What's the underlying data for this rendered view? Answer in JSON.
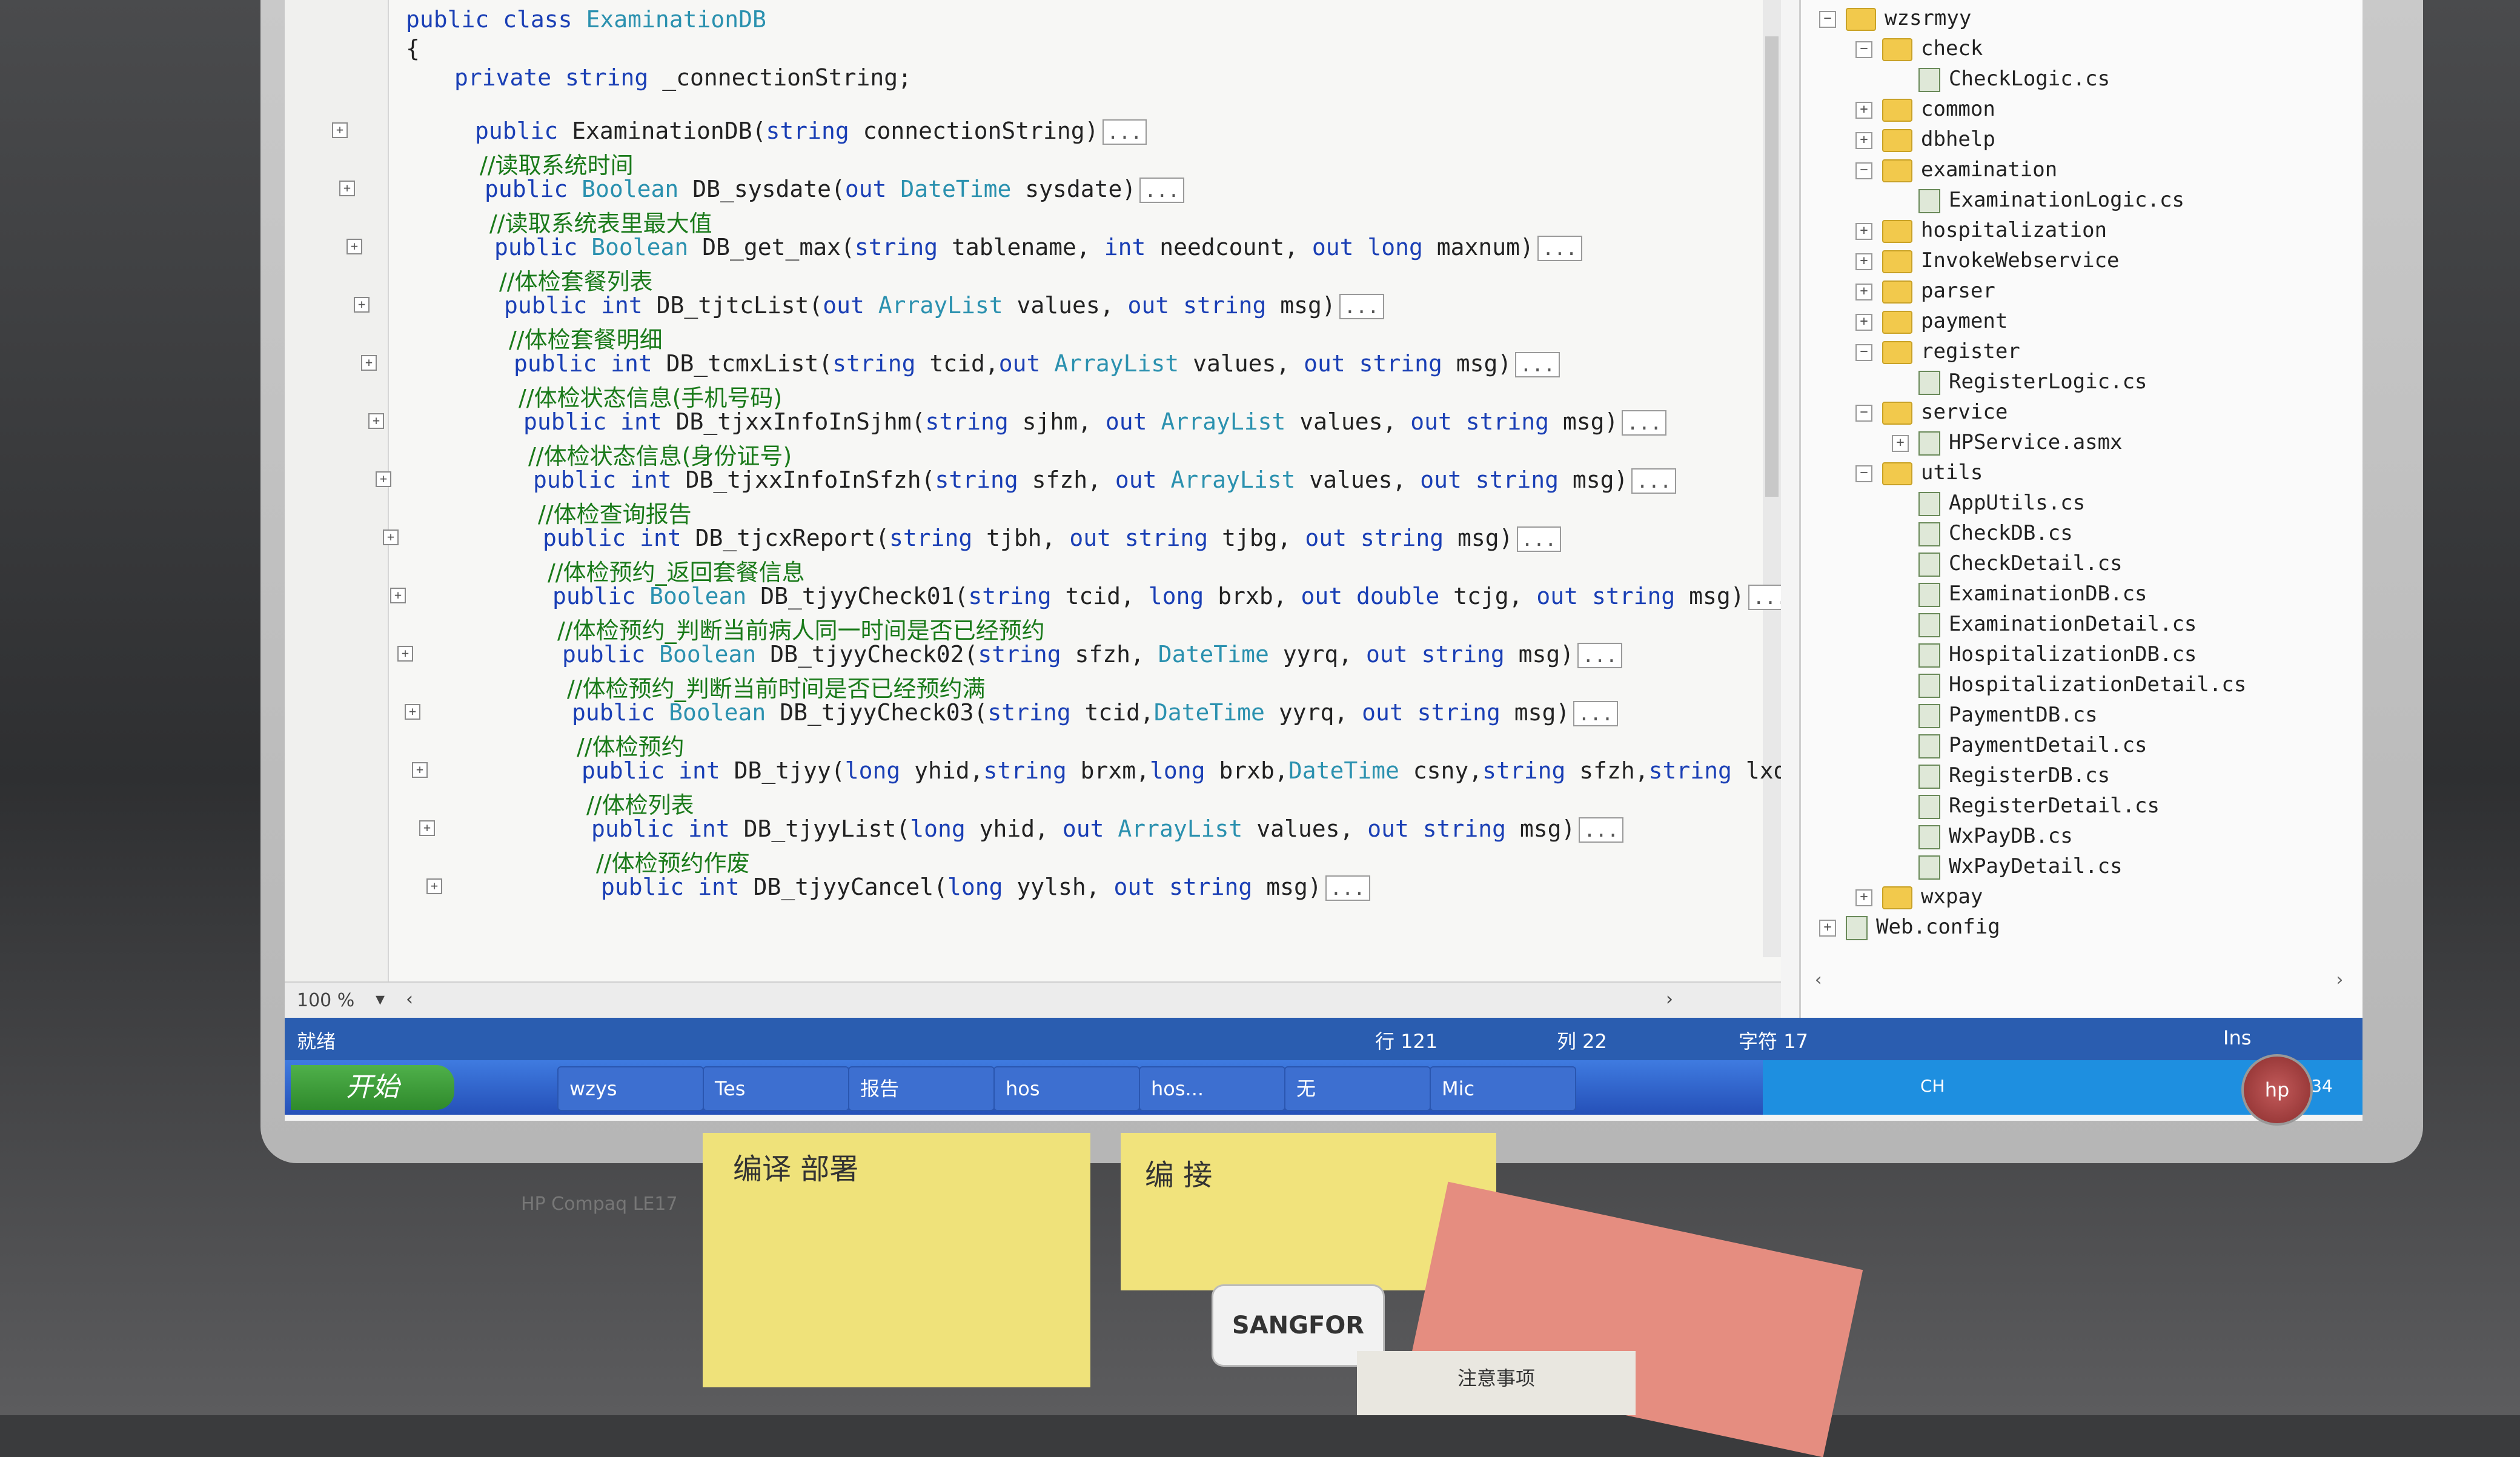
{
  "editor": {
    "zoom": "100 %",
    "lines": [
      {
        "kind": "code",
        "parts": [
          [
            "kw",
            "public "
          ],
          [
            "kw",
            "class "
          ],
          [
            "ty",
            "ExaminationDB"
          ]
        ]
      },
      {
        "kind": "code",
        "parts": [
          [
            "pl",
            "{"
          ]
        ]
      },
      {
        "kind": "code",
        "parts": [
          [
            "kw",
            "private "
          ],
          [
            "kw",
            "string "
          ],
          [
            "pl",
            "_connectionString;"
          ]
        ]
      },
      {
        "kind": "code",
        "parts": [
          [
            "kw",
            "public "
          ],
          [
            "pl",
            "ExaminationDB("
          ],
          [
            "kw",
            "string "
          ],
          [
            "pl",
            "connectionString)"
          ]
        ],
        "collapsed": "..."
      },
      {
        "kind": "comment",
        "text": "//读取系统时间"
      },
      {
        "kind": "code",
        "parts": [
          [
            "kw",
            "public "
          ],
          [
            "ty",
            "Boolean "
          ],
          [
            "pl",
            "DB_sysdate("
          ],
          [
            "kw",
            "out "
          ],
          [
            "ty",
            "DateTime "
          ],
          [
            "pl",
            "sysdate)"
          ]
        ],
        "collapsed": "..."
      },
      {
        "kind": "comment",
        "text": "//读取系统表里最大值"
      },
      {
        "kind": "code",
        "parts": [
          [
            "kw",
            "public "
          ],
          [
            "ty",
            "Boolean "
          ],
          [
            "pl",
            "DB_get_max("
          ],
          [
            "kw",
            "string "
          ],
          [
            "pl",
            "tablename, "
          ],
          [
            "kw",
            "int "
          ],
          [
            "pl",
            "needcount, "
          ],
          [
            "kw",
            "out "
          ],
          [
            "kw",
            "long "
          ],
          [
            "pl",
            "maxnum)"
          ]
        ],
        "collapsed": "..."
      },
      {
        "kind": "comment",
        "text": "//体检套餐列表"
      },
      {
        "kind": "code",
        "parts": [
          [
            "kw",
            "public "
          ],
          [
            "kw",
            "int "
          ],
          [
            "pl",
            "DB_tjtcList("
          ],
          [
            "kw",
            "out "
          ],
          [
            "ty",
            "ArrayList "
          ],
          [
            "pl",
            "values, "
          ],
          [
            "kw",
            "out "
          ],
          [
            "kw",
            "string "
          ],
          [
            "pl",
            "msg)"
          ]
        ],
        "collapsed": "..."
      },
      {
        "kind": "comment",
        "text": "//体检套餐明细"
      },
      {
        "kind": "code",
        "parts": [
          [
            "kw",
            "public "
          ],
          [
            "kw",
            "int "
          ],
          [
            "pl",
            "DB_tcmxList("
          ],
          [
            "kw",
            "string "
          ],
          [
            "pl",
            "tcid,"
          ],
          [
            "kw",
            "out "
          ],
          [
            "ty",
            "ArrayList "
          ],
          [
            "pl",
            "values, "
          ],
          [
            "kw",
            "out "
          ],
          [
            "kw",
            "string "
          ],
          [
            "pl",
            "msg)"
          ]
        ],
        "collapsed": "..."
      },
      {
        "kind": "comment",
        "text": "//体检状态信息(手机号码)"
      },
      {
        "kind": "code",
        "parts": [
          [
            "kw",
            "public "
          ],
          [
            "kw",
            "int "
          ],
          [
            "pl",
            "DB_tjxxInfoInSjhm("
          ],
          [
            "kw",
            "string "
          ],
          [
            "pl",
            "sjhm, "
          ],
          [
            "kw",
            "out "
          ],
          [
            "ty",
            "ArrayList "
          ],
          [
            "pl",
            "values, "
          ],
          [
            "kw",
            "out "
          ],
          [
            "kw",
            "string "
          ],
          [
            "pl",
            "msg)"
          ]
        ],
        "collapsed": "..."
      },
      {
        "kind": "comment",
        "text": "//体检状态信息(身份证号)"
      },
      {
        "kind": "code",
        "parts": [
          [
            "kw",
            "public "
          ],
          [
            "kw",
            "int "
          ],
          [
            "pl",
            "DB_tjxxInfoInSfzh("
          ],
          [
            "kw",
            "string "
          ],
          [
            "pl",
            "sfzh, "
          ],
          [
            "kw",
            "out "
          ],
          [
            "ty",
            "ArrayList "
          ],
          [
            "pl",
            "values, "
          ],
          [
            "kw",
            "out "
          ],
          [
            "kw",
            "string "
          ],
          [
            "pl",
            "msg)"
          ]
        ],
        "collapsed": "..."
      },
      {
        "kind": "comment",
        "text": "//体检查询报告"
      },
      {
        "kind": "code",
        "parts": [
          [
            "kw",
            "public "
          ],
          [
            "kw",
            "int "
          ],
          [
            "pl",
            "DB_tjcxReport("
          ],
          [
            "kw",
            "string "
          ],
          [
            "pl",
            "tjbh, "
          ],
          [
            "kw",
            "out "
          ],
          [
            "kw",
            "string "
          ],
          [
            "pl",
            "tjbg, "
          ],
          [
            "kw",
            "out "
          ],
          [
            "kw",
            "string "
          ],
          [
            "pl",
            "msg)"
          ]
        ],
        "collapsed": "..."
      },
      {
        "kind": "comment",
        "text": "//体检预约_返回套餐信息"
      },
      {
        "kind": "code",
        "parts": [
          [
            "kw",
            "public "
          ],
          [
            "ty",
            "Boolean "
          ],
          [
            "pl",
            "DB_tjyyCheck01("
          ],
          [
            "kw",
            "string "
          ],
          [
            "pl",
            "tcid, "
          ],
          [
            "kw",
            "long "
          ],
          [
            "pl",
            "brxb, "
          ],
          [
            "kw",
            "out "
          ],
          [
            "kw",
            "double "
          ],
          [
            "pl",
            "tcjg, "
          ],
          [
            "kw",
            "out "
          ],
          [
            "kw",
            "string "
          ],
          [
            "pl",
            "msg)"
          ]
        ],
        "collapsed": "..."
      },
      {
        "kind": "comment",
        "text": "//体检预约_判断当前病人同一时间是否已经预约"
      },
      {
        "kind": "code",
        "parts": [
          [
            "kw",
            "public "
          ],
          [
            "ty",
            "Boolean "
          ],
          [
            "pl",
            "DB_tjyyCheck02("
          ],
          [
            "kw",
            "string "
          ],
          [
            "pl",
            "sfzh, "
          ],
          [
            "ty",
            "DateTime "
          ],
          [
            "pl",
            "yyrq, "
          ],
          [
            "kw",
            "out "
          ],
          [
            "kw",
            "string "
          ],
          [
            "pl",
            "msg)"
          ]
        ],
        "collapsed": "..."
      },
      {
        "kind": "comment",
        "text": "//体检预约_判断当前时间是否已经预约满"
      },
      {
        "kind": "code",
        "parts": [
          [
            "kw",
            "public "
          ],
          [
            "ty",
            "Boolean "
          ],
          [
            "pl",
            "DB_tjyyCheck03("
          ],
          [
            "kw",
            "string "
          ],
          [
            "pl",
            "tcid,"
          ],
          [
            "ty",
            "DateTime "
          ],
          [
            "pl",
            "yyrq, "
          ],
          [
            "kw",
            "out "
          ],
          [
            "kw",
            "string "
          ],
          [
            "pl",
            "msg)"
          ]
        ],
        "collapsed": "..."
      },
      {
        "kind": "comment",
        "text": "//体检预约"
      },
      {
        "kind": "code",
        "parts": [
          [
            "kw",
            "public "
          ],
          [
            "kw",
            "int "
          ],
          [
            "pl",
            "DB_tjyy("
          ],
          [
            "kw",
            "long "
          ],
          [
            "pl",
            "yhid,"
          ],
          [
            "kw",
            "string "
          ],
          [
            "pl",
            "brxm,"
          ],
          [
            "kw",
            "long "
          ],
          [
            "pl",
            "brxb,"
          ],
          [
            "ty",
            "DateTime "
          ],
          [
            "pl",
            "csny,"
          ],
          [
            "kw",
            "string "
          ],
          [
            "pl",
            "sfzh,"
          ],
          [
            "kw",
            "string "
          ],
          [
            "pl",
            "lxdh,"
          ]
        ]
      },
      {
        "kind": "comment",
        "text": "//体检列表"
      },
      {
        "kind": "code",
        "parts": [
          [
            "kw",
            "public "
          ],
          [
            "kw",
            "int "
          ],
          [
            "pl",
            "DB_tjyyList("
          ],
          [
            "kw",
            "long "
          ],
          [
            "pl",
            "yhid, "
          ],
          [
            "kw",
            "out "
          ],
          [
            "ty",
            "ArrayList "
          ],
          [
            "pl",
            "values, "
          ],
          [
            "kw",
            "out "
          ],
          [
            "kw",
            "string "
          ],
          [
            "pl",
            "msg)"
          ]
        ],
        "collapsed": "..."
      },
      {
        "kind": "comment",
        "text": "//体检预约作废"
      },
      {
        "kind": "code",
        "parts": [
          [
            "kw",
            "public "
          ],
          [
            "kw",
            "int "
          ],
          [
            "pl",
            "DB_tjyyCancel("
          ],
          [
            "kw",
            "long "
          ],
          [
            "pl",
            "yylsh, "
          ],
          [
            "kw",
            "out "
          ],
          [
            "kw",
            "string "
          ],
          [
            "pl",
            "msg)"
          ]
        ],
        "collapsed": "..."
      }
    ]
  },
  "solution_tree": [
    {
      "label": "wzsrmyy",
      "type": "folder",
      "depth": 0,
      "expander": "−"
    },
    {
      "label": "check",
      "type": "folder",
      "depth": 1,
      "expander": "−"
    },
    {
      "label": "CheckLogic.cs",
      "type": "cs",
      "depth": 2,
      "expander": ""
    },
    {
      "label": "common",
      "type": "folder",
      "depth": 1,
      "expander": "+"
    },
    {
      "label": "dbhelp",
      "type": "folder",
      "depth": 1,
      "expander": "+"
    },
    {
      "label": "examination",
      "type": "folder",
      "depth": 1,
      "expander": "−"
    },
    {
      "label": "ExaminationLogic.cs",
      "type": "cs",
      "depth": 2,
      "expander": ""
    },
    {
      "label": "hospitalization",
      "type": "folder",
      "depth": 1,
      "expander": "+"
    },
    {
      "label": "InvokeWebservice",
      "type": "folder",
      "depth": 1,
      "expander": "+"
    },
    {
      "label": "parser",
      "type": "folder",
      "depth": 1,
      "expander": "+"
    },
    {
      "label": "payment",
      "type": "folder",
      "depth": 1,
      "expander": "+"
    },
    {
      "label": "register",
      "type": "folder",
      "depth": 1,
      "expander": "−"
    },
    {
      "label": "RegisterLogic.cs",
      "type": "cs",
      "depth": 2,
      "expander": ""
    },
    {
      "label": "service",
      "type": "folder",
      "depth": 1,
      "expander": "−"
    },
    {
      "label": "HPService.asmx",
      "type": "cs",
      "depth": 2,
      "expander": "+"
    },
    {
      "label": "utils",
      "type": "folder",
      "depth": 1,
      "expander": "−"
    },
    {
      "label": "AppUtils.cs",
      "type": "cs",
      "depth": 2,
      "expander": ""
    },
    {
      "label": "CheckDB.cs",
      "type": "cs",
      "depth": 2,
      "expander": ""
    },
    {
      "label": "CheckDetail.cs",
      "type": "cs",
      "depth": 2,
      "expander": ""
    },
    {
      "label": "ExaminationDB.cs",
      "type": "cs",
      "depth": 2,
      "expander": ""
    },
    {
      "label": "ExaminationDetail.cs",
      "type": "cs",
      "depth": 2,
      "expander": ""
    },
    {
      "label": "HospitalizationDB.cs",
      "type": "cs",
      "depth": 2,
      "expander": ""
    },
    {
      "label": "HospitalizationDetail.cs",
      "type": "cs",
      "depth": 2,
      "expander": ""
    },
    {
      "label": "PaymentDB.cs",
      "type": "cs",
      "depth": 2,
      "expander": ""
    },
    {
      "label": "PaymentDetail.cs",
      "type": "cs",
      "depth": 2,
      "expander": ""
    },
    {
      "label": "RegisterDB.cs",
      "type": "cs",
      "depth": 2,
      "expander": ""
    },
    {
      "label": "RegisterDetail.cs",
      "type": "cs",
      "depth": 2,
      "expander": ""
    },
    {
      "label": "WxPayDB.cs",
      "type": "cs",
      "depth": 2,
      "expander": ""
    },
    {
      "label": "WxPayDetail.cs",
      "type": "cs",
      "depth": 2,
      "expander": ""
    },
    {
      "label": "wxpay",
      "type": "folder",
      "depth": 1,
      "expander": "+"
    },
    {
      "label": "Web.config",
      "type": "cs",
      "depth": 0,
      "expander": "+"
    }
  ],
  "status_bar": {
    "ready": "就绪",
    "line": "行 121",
    "col": "列 22",
    "char": "字符 17",
    "mode": "Ins"
  },
  "taskbar": {
    "start": "开始",
    "buttons": [
      "wzys",
      "Tes",
      "报告",
      "hos",
      "hos...",
      "无",
      "Mic"
    ],
    "tray": [
      "CH",
      "15:34"
    ]
  },
  "desk": {
    "model": "HP Compaq LE17",
    "note1": "编译 部署",
    "note2": "编 接",
    "usb": "SANGFOR",
    "card": "注意事项"
  },
  "colors": {
    "keyword": "#1a3fb5",
    "type": "#2b91af",
    "comment": "#1a7a1a",
    "taskbar": "#2550b8",
    "status": "#2a5db0"
  }
}
